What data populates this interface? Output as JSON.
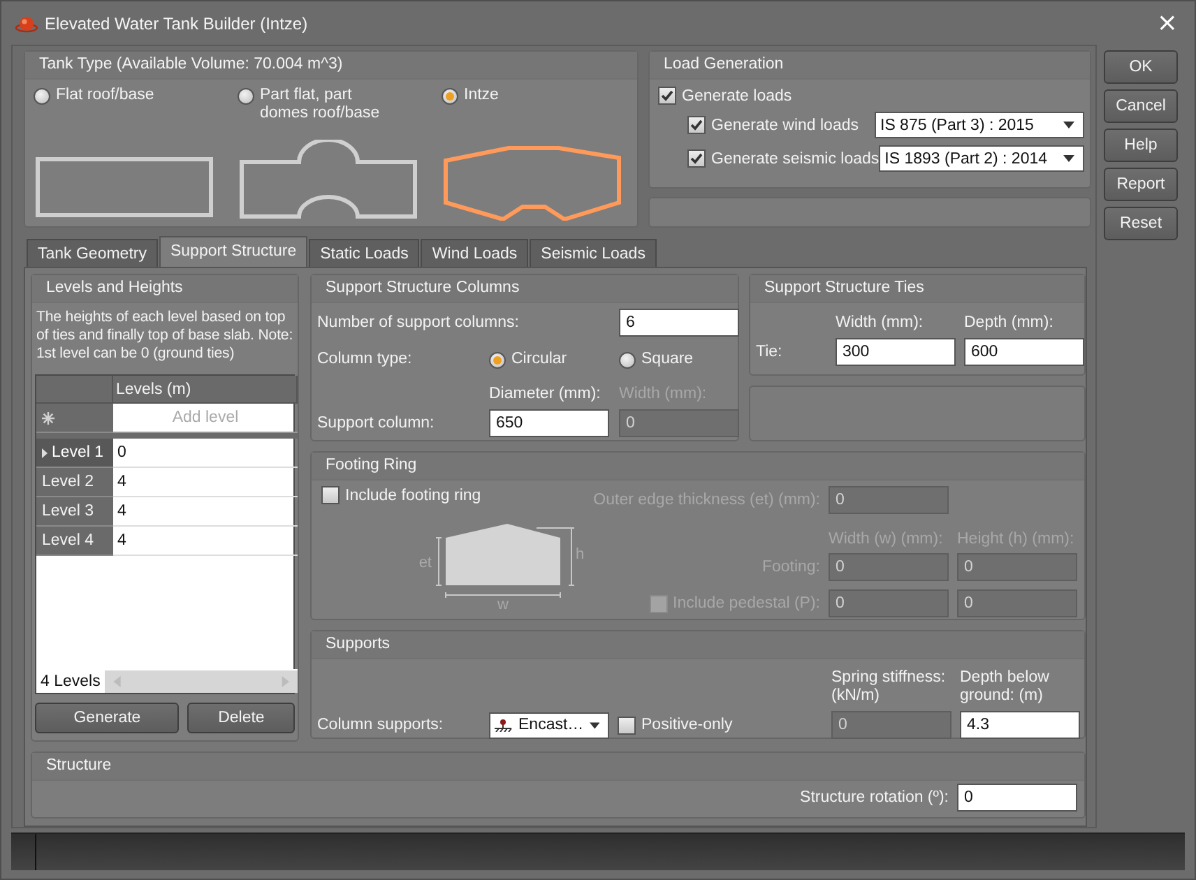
{
  "window": {
    "title": "Elevated Water Tank Builder (Intze)",
    "close": "×"
  },
  "tank_type": {
    "title": "Tank Type (Available Volume: 70.004 m^3)",
    "options": [
      {
        "label": "Flat roof/base",
        "kind": "flat",
        "selected": false
      },
      {
        "label": "Part flat, part domes roof/base",
        "kind": "domes",
        "selected": false
      },
      {
        "label": "Intze",
        "kind": "intze",
        "selected": true
      }
    ]
  },
  "load_generation": {
    "title": "Load Generation",
    "generate": {
      "label": "Generate loads",
      "checked": true
    },
    "codes": [
      {
        "label": "Generate wind loads",
        "checked": true,
        "value": "IS 875 (Part 3) : 2015"
      },
      {
        "label": "Generate seismic loads",
        "checked": true,
        "value": "IS 1893 (Part 2) : 2014"
      }
    ]
  },
  "buttons": [
    "OK",
    "Cancel",
    "Help",
    "Report",
    "Reset"
  ],
  "tabs": [
    {
      "label": "Tank Geometry",
      "selected": false
    },
    {
      "label": "Support Structure",
      "selected": true
    },
    {
      "label": "Static Loads",
      "selected": false
    },
    {
      "label": "Wind Loads",
      "selected": false
    },
    {
      "label": "Seismic Loads",
      "selected": false
    }
  ],
  "levels": {
    "title": "Levels and Heights",
    "note": "The heights of each level based on top of ties and finally top of base slab. Note: 1st level can be 0 (ground ties)",
    "column": "Levels (m)",
    "add_placeholder": "Add level",
    "rows": [
      {
        "name": "Level 1",
        "value": "0",
        "selected": true
      },
      {
        "name": "Level 2",
        "value": "4",
        "selected": false
      },
      {
        "name": "Level 3",
        "value": "4",
        "selected": false
      },
      {
        "name": "Level 4",
        "value": "4",
        "selected": false
      }
    ],
    "count": "4 Levels",
    "buttons": [
      "Generate",
      "Delete"
    ]
  },
  "columns": {
    "title": "Support Structure Columns",
    "count_label": "Number of support columns:",
    "count": {
      "value": "6",
      "disabled": false
    },
    "type_label": "Column type:",
    "types": [
      {
        "label": "Circular",
        "selected": true
      },
      {
        "label": "Square",
        "selected": false
      }
    ],
    "size_headers": [
      "Diameter (mm):",
      "Width (mm):"
    ],
    "row_label": "Support column:",
    "sizes": [
      {
        "value": "650",
        "disabled": false
      },
      {
        "value": "0",
        "disabled": true
      }
    ]
  },
  "ties": {
    "title": "Support Structure Ties",
    "headers": [
      "Width (mm):",
      "Depth (mm):"
    ],
    "row_label": "Tie:",
    "fields": [
      {
        "value": "300",
        "disabled": false
      },
      {
        "value": "600",
        "disabled": false
      }
    ]
  },
  "footing": {
    "title": "Footing Ring",
    "include": {
      "label": "Include footing ring",
      "checked": false
    },
    "edge_label": "Outer edge thickness (et) (mm):",
    "edge": {
      "value": "0",
      "disabled": true
    },
    "headers": [
      "Width (w) (mm):",
      "Height (h) (mm):"
    ],
    "footing_label": "Footing:",
    "footing_fields": [
      {
        "value": "0",
        "disabled": true
      },
      {
        "value": "0",
        "disabled": true
      }
    ],
    "pedestal": {
      "label": "Include pedestal (P):",
      "checked": false,
      "disabled": true
    },
    "pedestal_fields": [
      {
        "value": "0",
        "disabled": true
      },
      {
        "value": "0",
        "disabled": true
      }
    ],
    "diagram_labels": [
      "et",
      "h",
      "w"
    ]
  },
  "supports": {
    "title": "Supports",
    "label": "Column supports:",
    "type": "Encast…",
    "positive_only": {
      "label": "Positive-only",
      "checked": false
    },
    "headers": [
      "Spring stiffness: (kN/m)",
      "Depth below ground: (m)"
    ],
    "fields": [
      {
        "value": "0",
        "disabled": true
      },
      {
        "value": "4.3",
        "disabled": false
      }
    ]
  },
  "structure": {
    "title": "Structure",
    "rotation_label": "Structure rotation (º):",
    "rotation": {
      "value": "0",
      "disabled": false
    }
  }
}
